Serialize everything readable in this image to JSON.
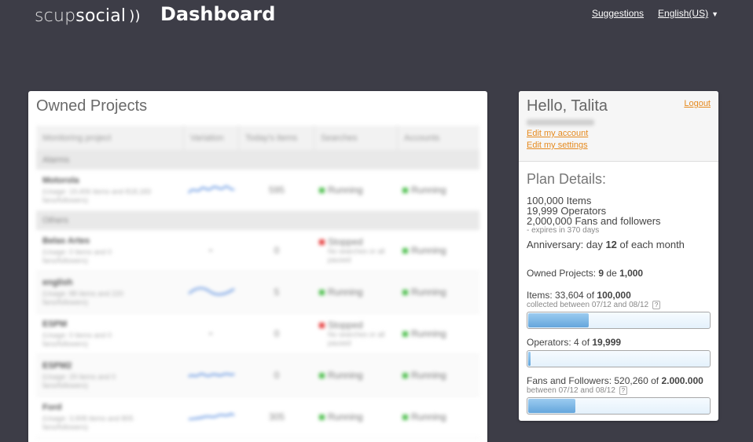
{
  "header": {
    "logo_scup": "scup",
    "logo_social": "social",
    "title": "Dashboard",
    "suggestions": "Suggestions",
    "language": "English(US)"
  },
  "projects": {
    "title": "Owned Projects",
    "columns": [
      "Monitoring project",
      "Variation",
      "Today's items",
      "Searches",
      "Accounts"
    ],
    "groups": [
      {
        "name": "Alarms",
        "rows": [
          {
            "name": "Motorola",
            "sub1": "(Usage: 19,406 items and 818,183",
            "sub2": "fans/followers)",
            "spark": "wave",
            "count": "595",
            "search": "Running",
            "search_state": "green",
            "search_sub": "",
            "accounts": "Running"
          }
        ]
      },
      {
        "name": "Others",
        "rows": [
          {
            "name": "Belas Artes",
            "sub1": "(Usage: 0 items and 0",
            "sub2": "fans/followers)",
            "spark": "dash",
            "count": "0",
            "search": "Stopped",
            "search_state": "red",
            "search_sub": "No searches or all paused",
            "accounts": "Running"
          },
          {
            "name": "english",
            "sub1": "(Usage: 88 items and 220",
            "sub2": "fans/followers)",
            "spark": "arc",
            "count": "5",
            "search": "Running",
            "search_state": "green",
            "search_sub": "",
            "accounts": "Running"
          },
          {
            "name": "ESPM",
            "sub1": "(Usage: 0 items and 0",
            "sub2": "fans/followers)",
            "spark": "dash",
            "count": "0",
            "search": "Stopped",
            "search_state": "red",
            "search_sub": "No searches or all paused",
            "accounts": "Running"
          },
          {
            "name": "ESPM2",
            "sub1": "(Usage: 29 items and 0",
            "sub2": "fans/followers)",
            "spark": "wave2",
            "count": "0",
            "search": "Running",
            "search_state": "green",
            "search_sub": "",
            "accounts": "Running"
          },
          {
            "name": "Ford",
            "sub1": "(Usage: 3,908 items and 805",
            "sub2": "fans/followers)",
            "spark": "wave3",
            "count": "305",
            "search": "Running",
            "search_state": "green",
            "search_sub": "",
            "accounts": "Running"
          }
        ]
      }
    ]
  },
  "user": {
    "greeting": "Hello, Talita",
    "logout": "Logout",
    "edit_account": "Edit my account",
    "edit_settings": "Edit my settings",
    "plan_title": "Plan Details:",
    "plan_items": "100,000 Items",
    "plan_operators": "19,999 Operators",
    "plan_fans": "2,000,000 Fans and followers",
    "expires": "- expires in 370 days",
    "anniv_prefix": "Anniversary: day ",
    "anniv_day": "12",
    "anniv_suffix": " of each month",
    "owned_prefix": "Owned Projects: ",
    "owned_count": "9",
    "owned_mid": " de ",
    "owned_max": "1,000",
    "items_prefix": "Items: 33,604 of ",
    "items_max": "100,000",
    "items_sub": "collected between 07/12 and 08/12",
    "items_fill": 0.336,
    "operators_prefix": "Operators: 4 of ",
    "operators_max": "19,999",
    "operators_fill": 0.0002,
    "fans_prefix": "Fans and Followers: 520,260 of ",
    "fans_max": "2.000.000",
    "fans_sub": "between 07/12 and 08/12",
    "fans_fill": 0.26,
    "help": "?"
  },
  "colors": {
    "background": "#3d3d47",
    "link_orange": "#e58a1f",
    "bar_blue": "#64a6dc",
    "running": "#4fbf4f",
    "stopped": "#e64040"
  }
}
